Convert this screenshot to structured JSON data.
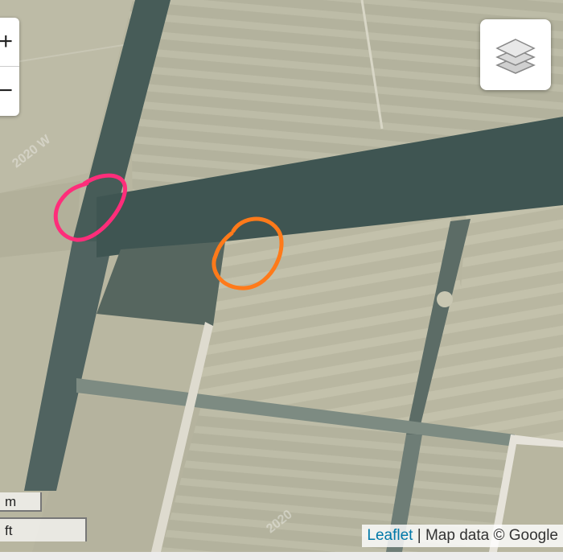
{
  "map": {
    "zoom_in_label": "+",
    "zoom_out_label": "−",
    "layers_icon": "layers-icon",
    "scale": {
      "metric_label": "m",
      "imperial_label": "ft"
    },
    "attribution": {
      "leaflet_label": "Leaflet",
      "separator": " | ",
      "data_label": "Map data © Google"
    },
    "watermarks": [
      "2020",
      "2020 W",
      "2020"
    ],
    "annotations": [
      {
        "type": "hand-drawn-circle",
        "color": "#ff2d7a"
      },
      {
        "type": "hand-drawn-circle",
        "color": "#ff7a1a"
      }
    ]
  }
}
